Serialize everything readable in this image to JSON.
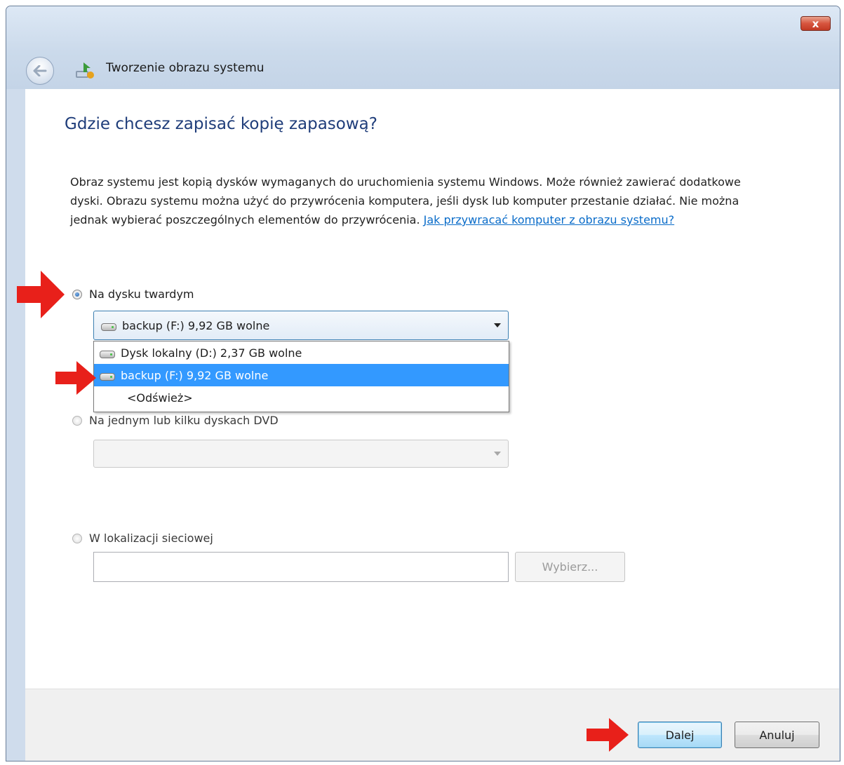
{
  "window": {
    "title": "Tworzenie obrazu systemu",
    "close_label": "x"
  },
  "page": {
    "heading": "Gdzie chcesz zapisać kopię zapasową?",
    "description": "Obraz systemu jest kopią dysków wymaganych do uruchomienia systemu Windows. Może również zawierać dodatkowe dyski. Obrazu systemu można użyć do przywrócenia komputera, jeśli dysk lub komputer przestanie działać. Nie można jednak wybierać poszczególnych elementów do przywrócenia.",
    "help_link": "Jak przywracać komputer z obrazu systemu?"
  },
  "options": {
    "hard_disk": {
      "label": "Na dysku twardym",
      "checked": true,
      "selected_value": "backup (F:) 9,92 GB wolne",
      "dropdown_items": [
        {
          "label": "Dysk lokalny (D:) 2,37 GB wolne",
          "icon": "drive-icon",
          "selected": false
        },
        {
          "label": "backup (F:) 9,92 GB wolne",
          "icon": "drive-icon",
          "selected": true
        },
        {
          "label": "<Odśwież>",
          "icon": "",
          "selected": false
        }
      ]
    },
    "dvd": {
      "label": "Na jednym lub kilku dyskach DVD",
      "checked": false,
      "selected_value": ""
    },
    "network": {
      "label": "W lokalizacji sieciowej",
      "checked": false,
      "path_value": "",
      "browse_label": "Wybierz..."
    }
  },
  "footer": {
    "next_label": "Dalej",
    "cancel_label": "Anuluj"
  },
  "colors": {
    "heading": "#1f3d7a",
    "link": "#0a6cc9",
    "selection": "#3399ff",
    "annotation_arrow": "#e8201a"
  }
}
